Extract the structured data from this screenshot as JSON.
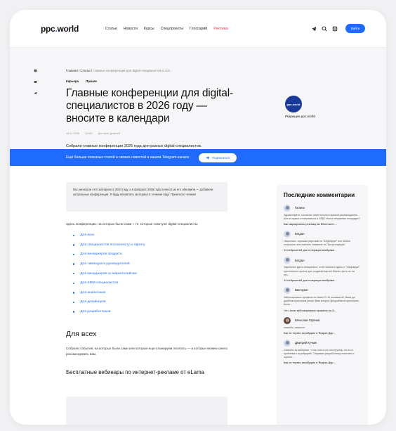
{
  "header": {
    "logo_main": "ppc",
    "logo_dot": ".",
    "logo_tail": "world",
    "nav": [
      "Статьи",
      "Новости",
      "Курсы",
      "Спецпроекты",
      "Глоссарий"
    ],
    "nav_highlight": "Реклама",
    "icons": [
      "telegram-icon",
      "search-icon",
      "bookmark-icon"
    ],
    "login_label": "Войти",
    "accent_color": "#1f6bff"
  },
  "hero": {
    "share_icons": [
      "vk-icon",
      "ok-icon",
      "telegram-icon"
    ],
    "breadcrumb_home": "Главная",
    "breadcrumb_sep1": " / ",
    "breadcrumb_section": "Статьи",
    "breadcrumb_sep2": " / ",
    "breadcrumb_current": "Главные конференции для digital-специалистов в 202...",
    "tags": [
      "Карьера",
      "Прочее"
    ],
    "title": "Главные конференции для digital-специалистов в 2026 году — вносите в календари",
    "meta": [
      "15.01.2026",
      "12160",
      "Для всех уровней"
    ],
    "lead": "Собрали главные конференции 2026 года для разных digital-специалистов.",
    "author_avatar_text": "ppc.world",
    "author_name": "Редакция ppc.world"
  },
  "telegram_banner": {
    "text": "Ещё больше полезных статей и свежих новостей в нашем Telegram‑канале",
    "button_label": "Подписаться"
  },
  "article": {
    "notice": "Мы написали этот материал в 2024 году, а в феврале 2026 года полностью его обновили — добавили актуальные конференции. Я буду обновлять материал в течение года. Приятного чтения!",
    "toc_intro": "Здесь конференции, на которых были сами + те, которые советуют digital‑специалисты:",
    "toc": [
      "Для всех",
      "Для специалистов по контексту и таргету",
      "Для менеджеров продукта",
      "Для тимлидов и руководителей",
      "Для менеджеров по маркетплейсам",
      "Для SMM‑специалистов",
      "Для аналитиков",
      "Для дизайнеров",
      "Для разработчиков"
    ],
    "section_title": "Для всех",
    "section_paragraph": "Собрали события, на которых были сами или которые еще планируем посетить — и которые можем смело рекомендовать вам.",
    "subsection_title": "Бесплатные вебинары по интернет‑рекламе от eLama"
  },
  "sidebar": {
    "title": "Последние комментарии",
    "comments": [
      {
        "name": "Галина",
        "text": "Здравствуйте, согласна: сами нельзя в прямой рекламодатель или на нужно отчитываться в ОРД? Или в неправных площадях?",
        "article": "Как маркировать рекламу во ВКонтакте:..."
      },
      {
        "name": "Богдан",
        "text": "Насколько, хорошая рирсчаск по \"Шедеврум\" или можно попросить или сменить название на \"Богулонаррум\"",
        "article": "14 нейросетей для генерации изображе..."
      },
      {
        "name": "Богдан",
        "text": "Зарегался здесь специально, этой написать здесь о \"Шедеврум\" престижного проект для создания картин бизнес фото но на это...",
        "article": "14 нейросетей для генерации изображе..."
      },
      {
        "name": "Виктория",
        "text": "Заблокировано профиль на Авито?! Не понимаете! Наши да удобном приложим решит Ваш вопрос! Декурабанов приложить были...",
        "article": "Что, если заблокировали профиль на А..."
      },
      {
        "name": "Вячеслав Горячев",
        "text": "спасибо, помогло!",
        "article": "Как не терять атрибуцию в Яндекс Дир..."
      },
      {
        "name": "Дмитрий Кучкин",
        "text": "Спасибо за материал. У нас хоть и не конструктор, но есть проблема с атрибуцией. Отправил разработчику почитать и оценил...",
        "article": "Как не терять атрибуцию в Яндекс Дир..."
      }
    ]
  }
}
